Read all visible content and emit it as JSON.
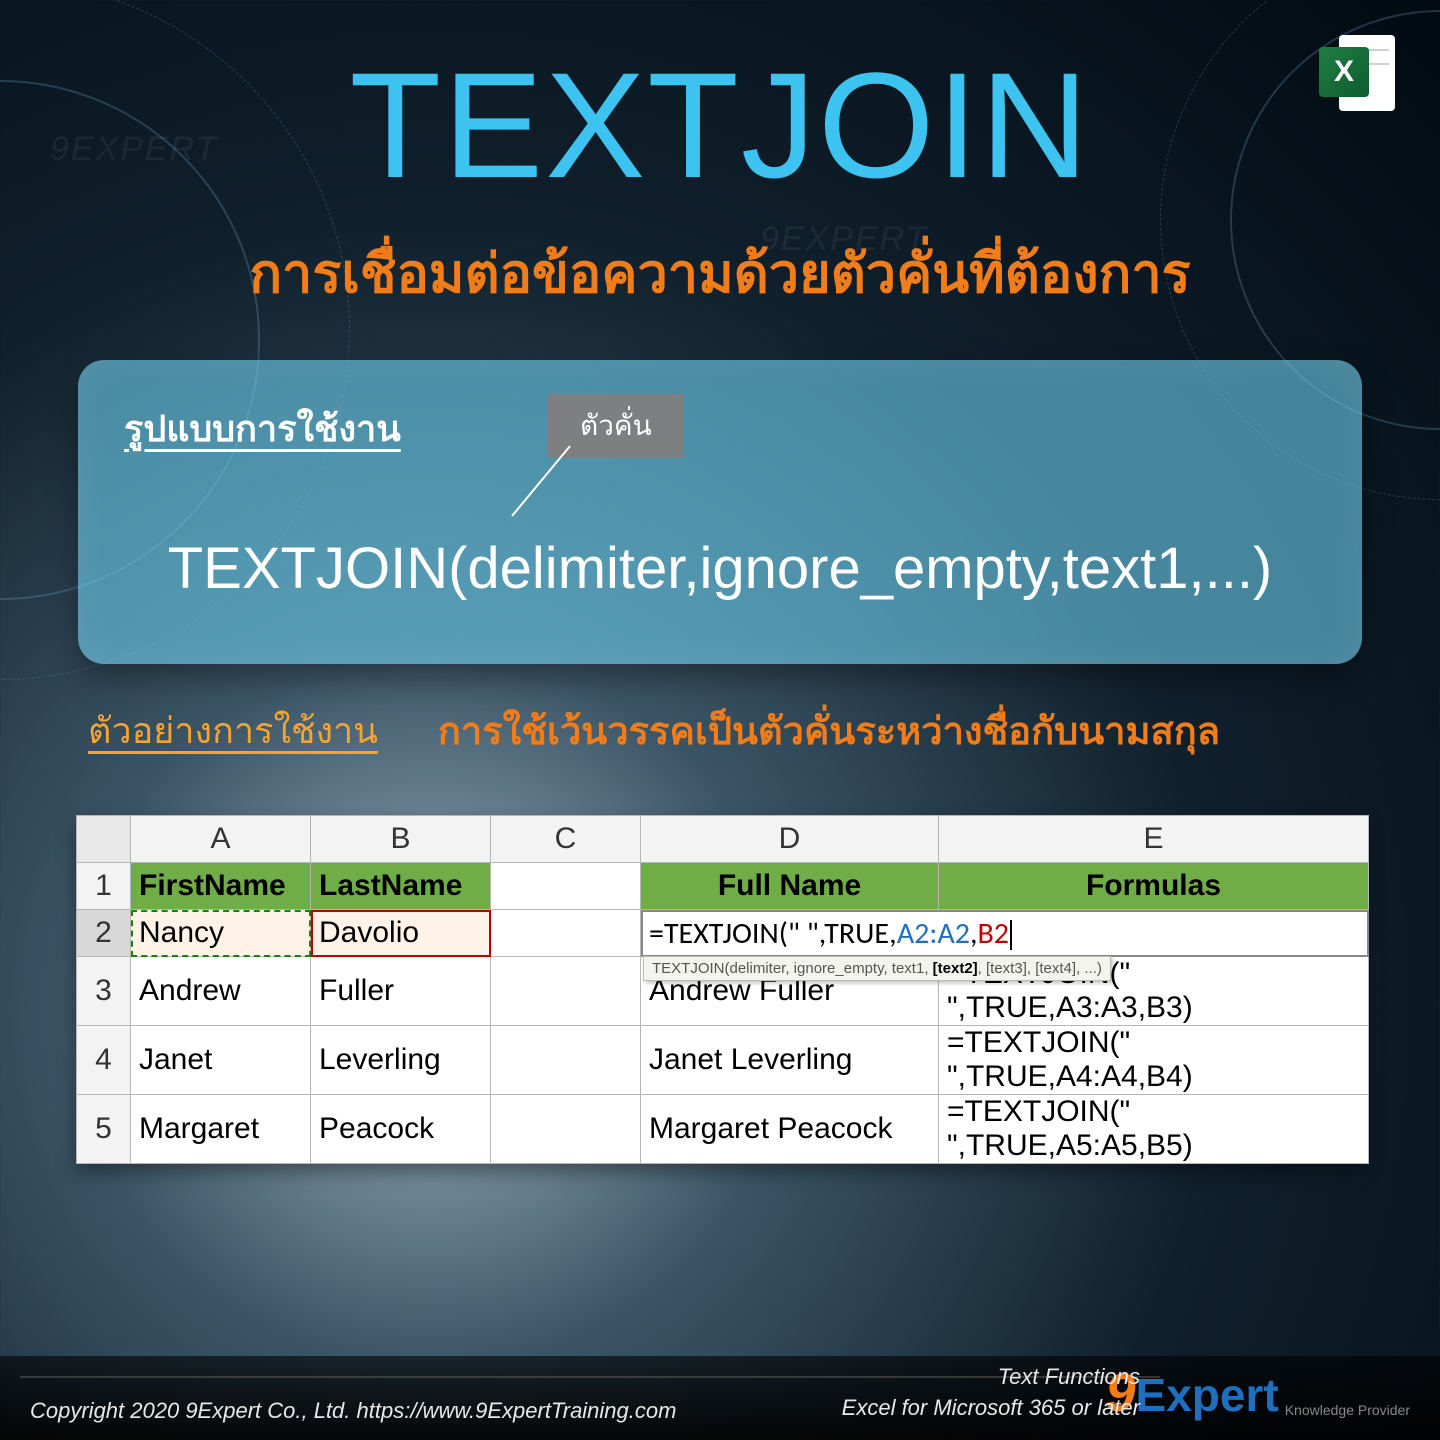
{
  "watermark": "9EXPERT",
  "excel_icon_letter": "X",
  "title": "TEXTJOIN",
  "subtitle": "การเชื่อมต่อข้อความด้วยตัวคั่นที่ต้องการ",
  "syntax": {
    "heading": "รูปแบบการใช้งาน",
    "chip": "ตัวคั่น",
    "formula": "TEXTJOIN(delimiter,ignore_empty,text1,...)"
  },
  "example": {
    "label": "ตัวอย่างการใช้งาน",
    "desc": "การใช้เว้นวรรคเป็นตัวคั่นระหว่างชื่อกับนามสกุล"
  },
  "sheet": {
    "col_letters": [
      "A",
      "B",
      "C",
      "D",
      "E"
    ],
    "row_numbers": [
      "1",
      "2",
      "3",
      "4",
      "5"
    ],
    "headers": {
      "A": "FirstName",
      "B": "LastName",
      "D": "Full Name",
      "E": "Formulas"
    },
    "rows": [
      {
        "first": "Nancy",
        "last": "Davolio",
        "full": "",
        "formula_parts": {
          "pre": "=TEXTJOIN(\" \",TRUE,",
          "r1": "A2:A2",
          "mid": ",",
          "r2": "B2",
          "post": ""
        }
      },
      {
        "first": "Andrew",
        "last": "Fuller",
        "full": "Andrew Fuller",
        "formula": "=TEXTJOIN(\" \",TRUE,A3:A3,B3)"
      },
      {
        "first": "Janet",
        "last": "Leverling",
        "full": "Janet Leverling",
        "formula": "=TEXTJOIN(\" \",TRUE,A4:A4,B4)"
      },
      {
        "first": "Margaret",
        "last": "Peacock",
        "full": "Margaret Peacock",
        "formula": "=TEXTJOIN(\" \",TRUE,A5:A5,B5)"
      }
    ],
    "tooltip": {
      "pre": "TEXTJOIN(delimiter, ignore_empty, text1, ",
      "bold": "[text2]",
      "post": ", [text3], [text4], ...)"
    }
  },
  "footer": {
    "copyright": "Copyright 2020 9Expert Co., Ltd.   https://www.9ExpertTraining.com",
    "cat": "Text Functions",
    "ver": "Excel for Microsoft 365 or later",
    "logo_nine": "9",
    "logo_text": "Expert",
    "logo_tag": "Knowledge Provider"
  }
}
